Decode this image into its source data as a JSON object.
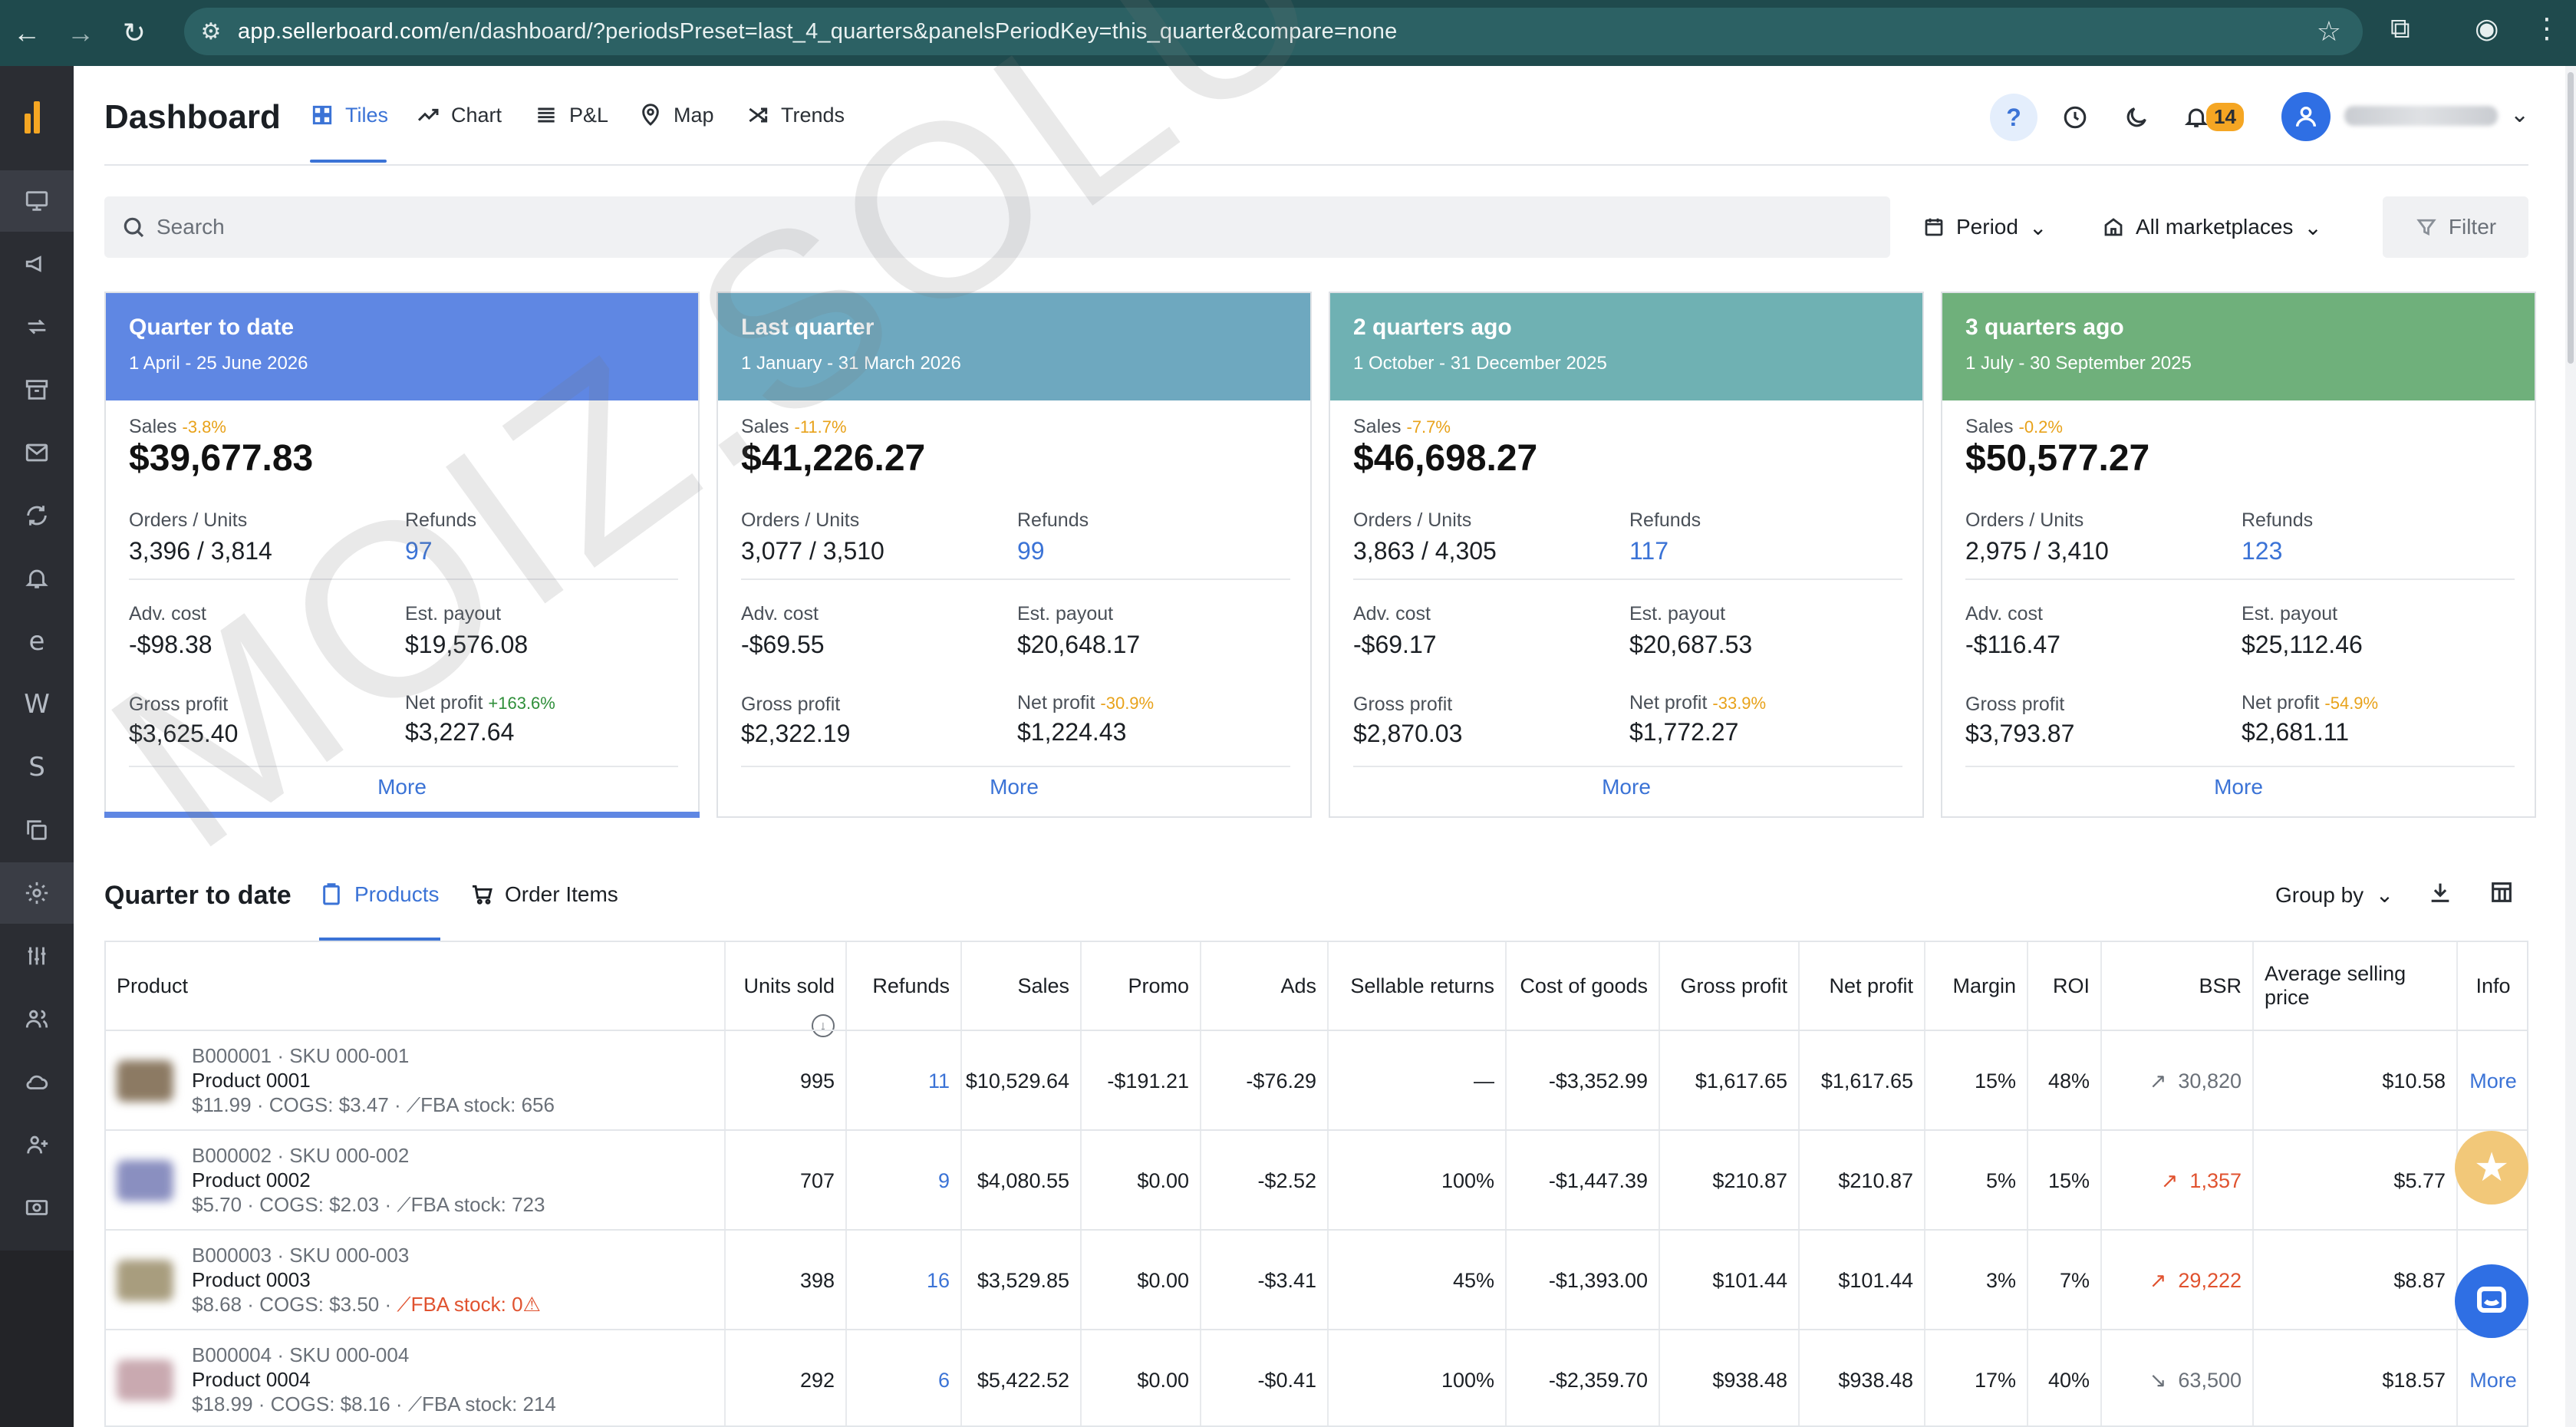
{
  "browser": {
    "url_host": "app.sellerboard.com",
    "url_path": "/en/dashboard/?periodsPreset=last_4_quarters&panelsPeriodKey=this_quarter&compare=none"
  },
  "header": {
    "title": "Dashboard",
    "tabs": [
      {
        "label": "Tiles",
        "icon": "tiles-icon",
        "active": true
      },
      {
        "label": "Chart",
        "icon": "chart-icon"
      },
      {
        "label": "P&L",
        "icon": "list-icon"
      },
      {
        "label": "Map",
        "icon": "map-pin-icon"
      },
      {
        "label": "Trends",
        "icon": "shuffle-icon"
      }
    ],
    "help_label": "?",
    "notification_count": "14"
  },
  "toolbar": {
    "search_placeholder": "Search",
    "period_label": "Period",
    "marketplaces_label": "All marketplaces",
    "filter_label": "Filter"
  },
  "cards": [
    {
      "title": "Quarter to date",
      "dates": "1 April - 25 June 2026",
      "color": "#5f87e3",
      "sales_label": "Sales",
      "sales_change": "-3.8%",
      "sales_value": "$39,677.83",
      "orders_label": "Orders / Units",
      "orders_value": "3,396 / 3,814",
      "refunds_label": "Refunds",
      "refunds_value": "97",
      "adv_label": "Adv. cost",
      "adv_value": "-$98.38",
      "payout_label": "Est. payout",
      "payout_value": "$19,576.08",
      "gross_label": "Gross profit",
      "gross_value": "$3,625.40",
      "net_label": "Net profit",
      "net_change": "+163.6%",
      "net_change_positive": true,
      "net_value": "$3,227.64",
      "more_label": "More"
    },
    {
      "title": "Last quarter",
      "dates": "1 January - 31 March 2026",
      "color": "#6ea8bf",
      "sales_label": "Sales",
      "sales_change": "-11.7%",
      "sales_value": "$41,226.27",
      "orders_label": "Orders / Units",
      "orders_value": "3,077 / 3,510",
      "refunds_label": "Refunds",
      "refunds_value": "99",
      "adv_label": "Adv. cost",
      "adv_value": "-$69.55",
      "payout_label": "Est. payout",
      "payout_value": "$20,648.17",
      "gross_label": "Gross profit",
      "gross_value": "$2,322.19",
      "net_label": "Net profit",
      "net_change": "-30.9%",
      "net_change_positive": false,
      "net_value": "$1,224.43",
      "more_label": "More"
    },
    {
      "title": "2 quarters ago",
      "dates": "1 October - 31 December 2025",
      "color": "#6fb1b3",
      "sales_label": "Sales",
      "sales_change": "-7.7%",
      "sales_value": "$46,698.27",
      "orders_label": "Orders / Units",
      "orders_value": "3,863 / 4,305",
      "refunds_label": "Refunds",
      "refunds_value": "117",
      "adv_label": "Adv. cost",
      "adv_value": "-$69.17",
      "payout_label": "Est. payout",
      "payout_value": "$20,687.53",
      "gross_label": "Gross profit",
      "gross_value": "$2,870.03",
      "net_label": "Net profit",
      "net_change": "-33.9%",
      "net_change_positive": false,
      "net_value": "$1,772.27",
      "more_label": "More"
    },
    {
      "title": "3 quarters ago",
      "dates": "1 July - 30 September 2025",
      "color": "#6fb07b",
      "sales_label": "Sales",
      "sales_change": "-0.2%",
      "sales_value": "$50,577.27",
      "orders_label": "Orders / Units",
      "orders_value": "2,975 / 3,410",
      "refunds_label": "Refunds",
      "refunds_value": "123",
      "adv_label": "Adv. cost",
      "adv_value": "-$116.47",
      "payout_label": "Est. payout",
      "payout_value": "$25,112.46",
      "gross_label": "Gross profit",
      "gross_value": "$3,793.87",
      "net_label": "Net profit",
      "net_change": "-54.9%",
      "net_change_positive": false,
      "net_value": "$2,681.11",
      "more_label": "More"
    }
  ],
  "section": {
    "title": "Quarter to date",
    "tabs": [
      {
        "label": "Products",
        "icon": "clipboard-icon",
        "active": true
      },
      {
        "label": "Order Items",
        "icon": "cart-icon"
      }
    ],
    "group_by_label": "Group by"
  },
  "table": {
    "columns": [
      "Product",
      "Units sold",
      "Refunds",
      "Sales",
      "Promo",
      "Ads",
      "Sellable returns",
      "Cost of goods",
      "Gross profit",
      "Net profit",
      "Margin",
      "ROI",
      "BSR",
      "Average selling price",
      "Info"
    ],
    "rows": [
      {
        "sku_line": "B000001 · SKU 000-001",
        "name": "Product 0001",
        "price_line": "$11.99 · COGS: $3.47 ·",
        "stock": "FBA stock: 656",
        "stock_warn": false,
        "units": "995",
        "refunds": "11",
        "sales": "$10,529.64",
        "promo": "-$191.21",
        "ads": "-$76.29",
        "sellable": "—",
        "cogs": "-$3,352.99",
        "gross": "$1,617.65",
        "net": "$1,617.65",
        "margin": "15%",
        "roi": "48%",
        "bsr": "30,820",
        "bsr_trend": "up-neutral",
        "asp": "$10.58",
        "info": "More",
        "img_color": "#8c7a63"
      },
      {
        "sku_line": "B000002 · SKU 000-002",
        "name": "Product 0002",
        "price_line": "$5.70 · COGS: $2.03 ·",
        "stock": "FBA stock: 723",
        "stock_warn": false,
        "units": "707",
        "refunds": "9",
        "sales": "$4,080.55",
        "promo": "$0.00",
        "ads": "-$2.52",
        "sellable": "100%",
        "cogs": "-$1,447.39",
        "gross": "$210.87",
        "net": "$210.87",
        "margin": "5%",
        "roi": "15%",
        "bsr": "1,357",
        "bsr_trend": "up-red",
        "asp": "$5.77",
        "info": "",
        "img_color": "#8a8fc0"
      },
      {
        "sku_line": "B000003 · SKU 000-003",
        "name": "Product 0003",
        "price_line": "$8.68 · COGS: $3.50 ·",
        "stock": "FBA stock: 0",
        "stock_warn": true,
        "units": "398",
        "refunds": "16",
        "sales": "$3,529.85",
        "promo": "$0.00",
        "ads": "-$3.41",
        "sellable": "45%",
        "cogs": "-$1,393.00",
        "gross": "$101.44",
        "net": "$101.44",
        "margin": "3%",
        "roi": "7%",
        "bsr": "29,222",
        "bsr_trend": "up-red",
        "asp": "$8.87",
        "info": "",
        "img_color": "#a89d7e"
      },
      {
        "sku_line": "B000004 · SKU 000-004",
        "name": "Product 0004",
        "price_line": "$18.99 · COGS: $8.16 ·",
        "stock": "FBA stock: 214",
        "stock_warn": false,
        "units": "292",
        "refunds": "6",
        "sales": "$5,422.52",
        "promo": "$0.00",
        "ads": "-$0.41",
        "sellable": "100%",
        "cogs": "-$2,359.70",
        "gross": "$938.48",
        "net": "$938.48",
        "margin": "17%",
        "roi": "40%",
        "bsr": "63,500",
        "bsr_trend": "down-neutral",
        "asp": "$18.57",
        "info": "More",
        "img_color": "#c9a9b0"
      }
    ]
  },
  "watermark": "MOIZ.SOLUTIONS"
}
